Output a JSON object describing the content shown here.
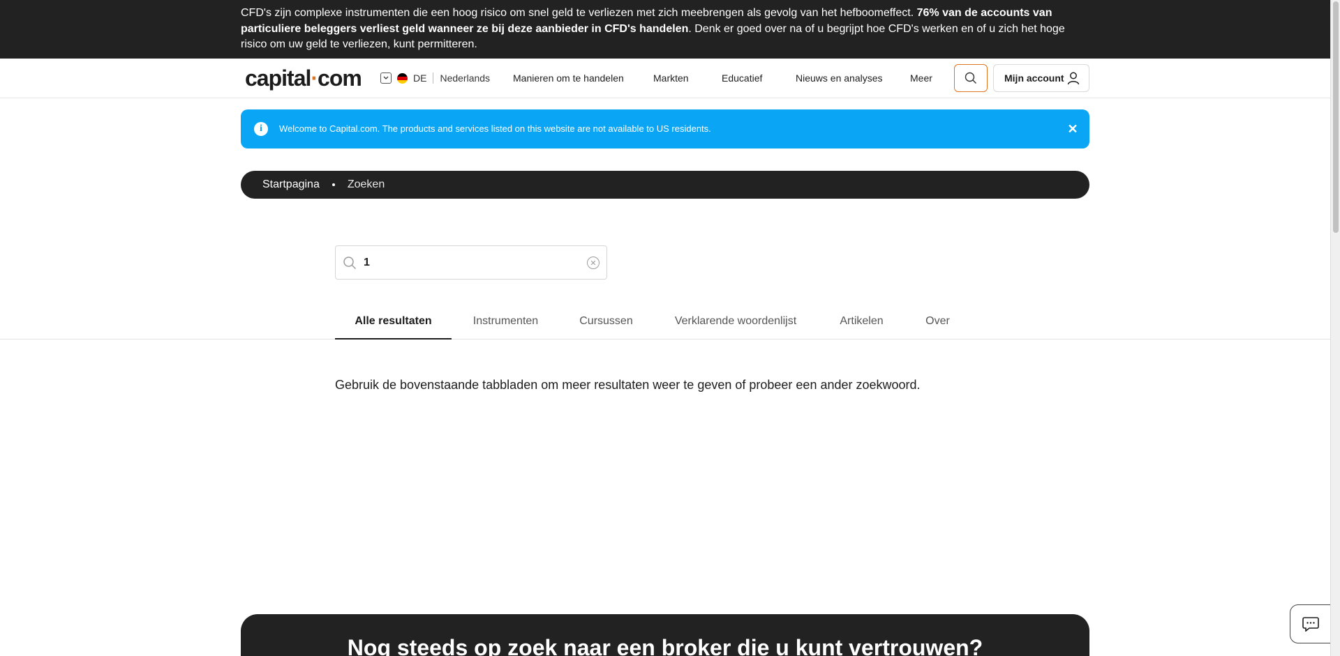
{
  "risk_banner": {
    "text_before": "CFD's zijn complexe instrumenten die een hoog risico om snel geld te verliezen met zich meebrengen als gevolg van het hefboomeffect. ",
    "text_bold": "76% van de accounts van particuliere beleggers verliest geld wanneer ze bij deze aanbieder in CFD's handelen",
    "text_after": ". Denk er goed over na of u begrijpt hoe CFD's werken en of u zich het hoge risico om uw geld te verliezen, kunt permitteren."
  },
  "header": {
    "logo_part1": "capital",
    "logo_dot": "·",
    "logo_part2": "com",
    "country_code": "DE",
    "language": "Nederlands",
    "nav": [
      "Manieren om te handelen",
      "Markten",
      "Educatief",
      "Nieuws en analyses",
      "Meer"
    ],
    "account_label": "Mijn account"
  },
  "welcome": {
    "message": "Welcome to Capital.com. The products and services listed on this website are not available to US residents.",
    "close": "✕"
  },
  "breadcrumb": {
    "home": "Startpagina",
    "current": "Zoeken"
  },
  "search": {
    "value": "1"
  },
  "tabs": [
    "Alle resultaten",
    "Instrumenten",
    "Cursussen",
    "Verklarende woordenlijst",
    "Artikelen",
    "Over"
  ],
  "active_tab": 0,
  "hint": "Gebruik de bovenstaande tabbladen om meer resultaten weer te geven of probeer een ander zoekwoord.",
  "cta": {
    "title": "Nog steeds op zoek naar een broker die u kunt vertrouwen?"
  },
  "colors": {
    "accent": "#e0731f",
    "info_blue": "#0aa5f5",
    "dark": "#222222"
  }
}
